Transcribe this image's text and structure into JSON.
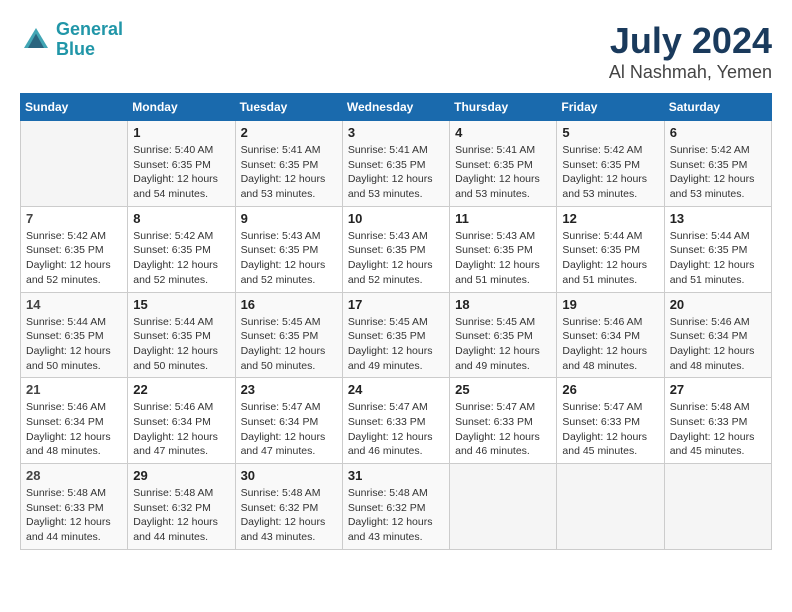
{
  "header": {
    "logo_line1": "General",
    "logo_line2": "Blue",
    "title": "July 2024",
    "subtitle": "Al Nashmah, Yemen"
  },
  "weekdays": [
    "Sunday",
    "Monday",
    "Tuesday",
    "Wednesday",
    "Thursday",
    "Friday",
    "Saturday"
  ],
  "weeks": [
    [
      {
        "day": "",
        "info": ""
      },
      {
        "day": "1",
        "info": "Sunrise: 5:40 AM\nSunset: 6:35 PM\nDaylight: 12 hours\nand 54 minutes."
      },
      {
        "day": "2",
        "info": "Sunrise: 5:41 AM\nSunset: 6:35 PM\nDaylight: 12 hours\nand 53 minutes."
      },
      {
        "day": "3",
        "info": "Sunrise: 5:41 AM\nSunset: 6:35 PM\nDaylight: 12 hours\nand 53 minutes."
      },
      {
        "day": "4",
        "info": "Sunrise: 5:41 AM\nSunset: 6:35 PM\nDaylight: 12 hours\nand 53 minutes."
      },
      {
        "day": "5",
        "info": "Sunrise: 5:42 AM\nSunset: 6:35 PM\nDaylight: 12 hours\nand 53 minutes."
      },
      {
        "day": "6",
        "info": "Sunrise: 5:42 AM\nSunset: 6:35 PM\nDaylight: 12 hours\nand 53 minutes."
      }
    ],
    [
      {
        "day": "7",
        "info": "Sunrise: 5:42 AM\nSunset: 6:35 PM\nDaylight: 12 hours\nand 52 minutes."
      },
      {
        "day": "8",
        "info": "Sunrise: 5:42 AM\nSunset: 6:35 PM\nDaylight: 12 hours\nand 52 minutes."
      },
      {
        "day": "9",
        "info": "Sunrise: 5:43 AM\nSunset: 6:35 PM\nDaylight: 12 hours\nand 52 minutes."
      },
      {
        "day": "10",
        "info": "Sunrise: 5:43 AM\nSunset: 6:35 PM\nDaylight: 12 hours\nand 52 minutes."
      },
      {
        "day": "11",
        "info": "Sunrise: 5:43 AM\nSunset: 6:35 PM\nDaylight: 12 hours\nand 51 minutes."
      },
      {
        "day": "12",
        "info": "Sunrise: 5:44 AM\nSunset: 6:35 PM\nDaylight: 12 hours\nand 51 minutes."
      },
      {
        "day": "13",
        "info": "Sunrise: 5:44 AM\nSunset: 6:35 PM\nDaylight: 12 hours\nand 51 minutes."
      }
    ],
    [
      {
        "day": "14",
        "info": "Sunrise: 5:44 AM\nSunset: 6:35 PM\nDaylight: 12 hours\nand 50 minutes."
      },
      {
        "day": "15",
        "info": "Sunrise: 5:44 AM\nSunset: 6:35 PM\nDaylight: 12 hours\nand 50 minutes."
      },
      {
        "day": "16",
        "info": "Sunrise: 5:45 AM\nSunset: 6:35 PM\nDaylight: 12 hours\nand 50 minutes."
      },
      {
        "day": "17",
        "info": "Sunrise: 5:45 AM\nSunset: 6:35 PM\nDaylight: 12 hours\nand 49 minutes."
      },
      {
        "day": "18",
        "info": "Sunrise: 5:45 AM\nSunset: 6:35 PM\nDaylight: 12 hours\nand 49 minutes."
      },
      {
        "day": "19",
        "info": "Sunrise: 5:46 AM\nSunset: 6:34 PM\nDaylight: 12 hours\nand 48 minutes."
      },
      {
        "day": "20",
        "info": "Sunrise: 5:46 AM\nSunset: 6:34 PM\nDaylight: 12 hours\nand 48 minutes."
      }
    ],
    [
      {
        "day": "21",
        "info": "Sunrise: 5:46 AM\nSunset: 6:34 PM\nDaylight: 12 hours\nand 48 minutes."
      },
      {
        "day": "22",
        "info": "Sunrise: 5:46 AM\nSunset: 6:34 PM\nDaylight: 12 hours\nand 47 minutes."
      },
      {
        "day": "23",
        "info": "Sunrise: 5:47 AM\nSunset: 6:34 PM\nDaylight: 12 hours\nand 47 minutes."
      },
      {
        "day": "24",
        "info": "Sunrise: 5:47 AM\nSunset: 6:33 PM\nDaylight: 12 hours\nand 46 minutes."
      },
      {
        "day": "25",
        "info": "Sunrise: 5:47 AM\nSunset: 6:33 PM\nDaylight: 12 hours\nand 46 minutes."
      },
      {
        "day": "26",
        "info": "Sunrise: 5:47 AM\nSunset: 6:33 PM\nDaylight: 12 hours\nand 45 minutes."
      },
      {
        "day": "27",
        "info": "Sunrise: 5:48 AM\nSunset: 6:33 PM\nDaylight: 12 hours\nand 45 minutes."
      }
    ],
    [
      {
        "day": "28",
        "info": "Sunrise: 5:48 AM\nSunset: 6:33 PM\nDaylight: 12 hours\nand 44 minutes."
      },
      {
        "day": "29",
        "info": "Sunrise: 5:48 AM\nSunset: 6:32 PM\nDaylight: 12 hours\nand 44 minutes."
      },
      {
        "day": "30",
        "info": "Sunrise: 5:48 AM\nSunset: 6:32 PM\nDaylight: 12 hours\nand 43 minutes."
      },
      {
        "day": "31",
        "info": "Sunrise: 5:48 AM\nSunset: 6:32 PM\nDaylight: 12 hours\nand 43 minutes."
      },
      {
        "day": "",
        "info": ""
      },
      {
        "day": "",
        "info": ""
      },
      {
        "day": "",
        "info": ""
      }
    ]
  ]
}
